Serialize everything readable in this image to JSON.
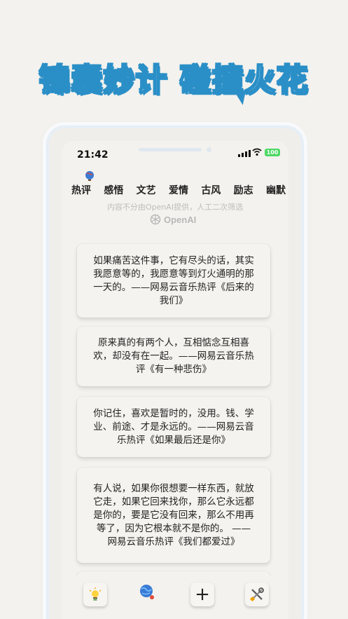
{
  "headline": "锦囊妙计 碰撞火花",
  "status": {
    "time": "21:42",
    "battery": "100"
  },
  "tabs": [
    {
      "label": "热评"
    },
    {
      "label": "感悟"
    },
    {
      "label": "文艺"
    },
    {
      "label": "爱情"
    },
    {
      "label": "古风"
    },
    {
      "label": "励志"
    },
    {
      "label": "幽默"
    }
  ],
  "notice": "内容不分由OpenAI提供，人工二次筛选",
  "openai_label": "OpenAI",
  "cards": [
    {
      "text": "如果痛苦这件事，它有尽头的话，其实我愿意等的，我愿意等到灯火通明的那一天的。——网易云音乐热评《后来的我们》"
    },
    {
      "text": "原来真的有两个人，互相惦念互相喜欢，却没有在一起。——网易云音乐热评《有一种悲伤》"
    },
    {
      "text": "你记住，喜欢是暂时的，没用。钱、学业、前途、才是永远的。——网易云音乐热评《如果最后还是你》"
    },
    {
      "text": "有人说，如果你很想要一样东西，就放它走，如果它回来找你，那么它永远都是你的，要是它没有回来，那么不用再等了，因为它根本就不是你的。 ——网易云音乐热评《我们都爱过》"
    }
  ],
  "toolbar": {
    "icons": [
      "lightbulb-icon",
      "globe-icon",
      "plus-icon",
      "tools-icon"
    ],
    "plus_label": "+"
  }
}
